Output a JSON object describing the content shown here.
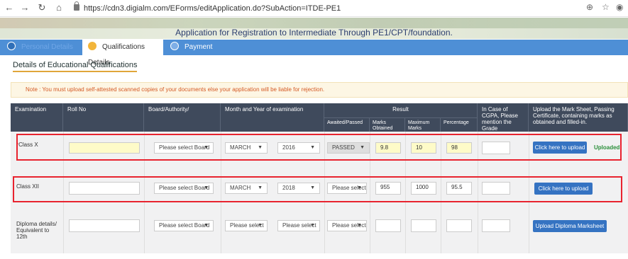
{
  "browser": {
    "url": "https://cdn3.digialm.com/EForms/editApplication.do?SubAction=ITDE-PE1"
  },
  "banner": {
    "title": "Application for Registration to Intermediate Through PE1/CPT/foundation."
  },
  "tabs": [
    {
      "label": "Personal Details"
    },
    {
      "label": "Qualifications Details"
    },
    {
      "label": "Payment Details"
    }
  ],
  "section_title": "Details of Educational Qualifications",
  "note": "Note : You must upload self-attested scanned copies of your documents else your application will be liable for rejection.",
  "headers": {
    "examination": "Examination",
    "roll_no": "Roll No",
    "board": "Board/Authority/",
    "month_year": "Month and Year of examination",
    "result": "Result",
    "awaited": "Awaited/Passed",
    "marks_obtained": "Marks Obtained",
    "max_marks": "Maximum Marks",
    "percentage": "Percentage",
    "cgpa": "In Case of CGPA, Please mention the Grade",
    "upload": "Upload the Mark Sheet, Passing Certificate, containing marks as obtained and filled-in."
  },
  "rows": [
    {
      "label": "Class X",
      "required": "*",
      "roll_no": "",
      "board": "Please select Board",
      "month": "MARCH",
      "year": "2016",
      "status": "PASSED",
      "marks": "9.8",
      "max": "10",
      "pct": "98",
      "grade": "",
      "button": "Click here to upload",
      "uploaded": "Uploaded"
    },
    {
      "label": "Class XII",
      "roll_no": "",
      "board": "Please select Board",
      "month": "MARCH",
      "year": "2018",
      "status": "Please select",
      "marks": "955",
      "max": "1000",
      "pct": "95.5",
      "grade": "",
      "button": "Click here to upload"
    },
    {
      "label": "Diploma details/ Equivalent to 12th",
      "roll_no": "",
      "board": "Please select Board",
      "month": "Please select",
      "year": "Please select",
      "status": "Please select",
      "marks": "",
      "max": "",
      "pct": "",
      "grade": "",
      "button": "Upload Diploma Marksheet"
    }
  ],
  "colors": {
    "header_bg": "#3f4a5c",
    "tab_bar": "#4e8fd6",
    "button": "#3573c2",
    "highlight": "#e8232f"
  }
}
